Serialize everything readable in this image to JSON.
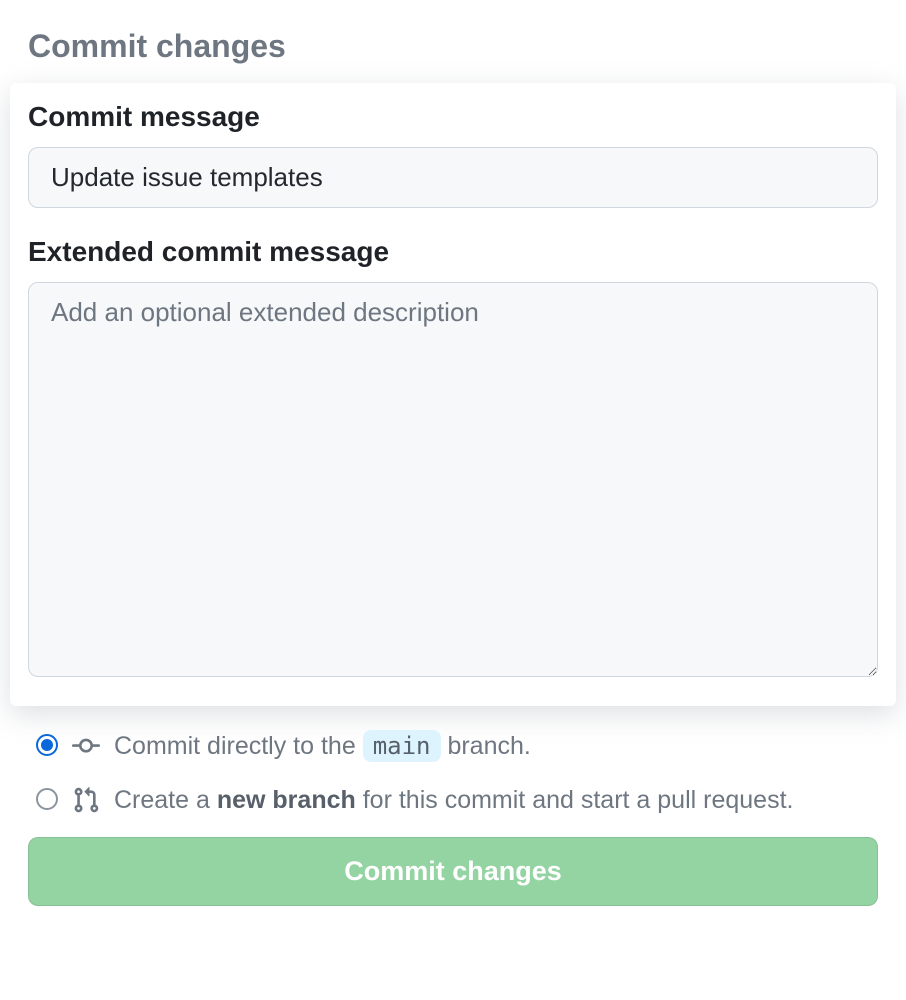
{
  "page": {
    "title": "Commit changes"
  },
  "commit": {
    "message_label": "Commit message",
    "message_value": "Update issue templates",
    "extended_label": "Extended commit message",
    "extended_placeholder": "Add an optional extended description"
  },
  "branch_options": {
    "direct_prefix": "Commit directly to the",
    "direct_branch": "main",
    "direct_suffix": "branch.",
    "new_prefix": "Create a",
    "new_bold": "new branch",
    "new_suffix": "for this commit and start a pull request."
  },
  "button": {
    "commit_label": "Commit changes"
  }
}
